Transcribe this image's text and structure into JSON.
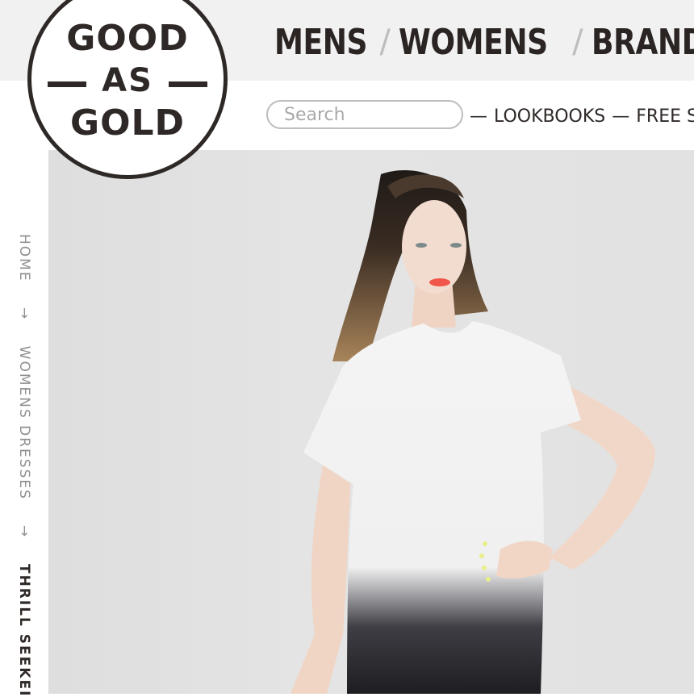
{
  "logo": {
    "line1": "GOOD",
    "line2": "AS",
    "line3": "GOLD"
  },
  "main_nav": {
    "items": [
      "MENS",
      "WOMENS",
      "BRAND"
    ],
    "separator": "/"
  },
  "search": {
    "placeholder": "Search"
  },
  "sub_nav": {
    "dash": "—",
    "items": [
      "LOOKBOOKS",
      "FREE SH"
    ]
  },
  "breadcrumb": {
    "items": [
      "HOME",
      "WOMENS DRESSES"
    ],
    "arrow": "→",
    "current": "THRILL SEEKEI"
  },
  "hero": {
    "icon": "product-photo"
  }
}
